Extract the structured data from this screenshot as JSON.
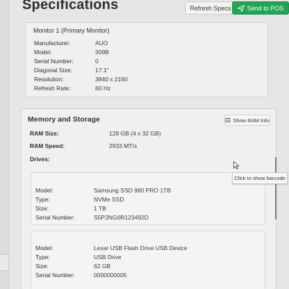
{
  "header": {
    "title": "Specifications",
    "refresh_label": "Refresh Specs",
    "send_label": "Send to POS"
  },
  "monitor": {
    "title": "Monitor 1 (Primary Monitor)",
    "rows": [
      {
        "label": "Manufacturer:",
        "value": "AUO"
      },
      {
        "label": "Model:",
        "value": "309B"
      },
      {
        "label": "Serial Number:",
        "value": "0"
      },
      {
        "label": "Diagonal Size:",
        "value": "17.1\""
      },
      {
        "label": "Resolution:",
        "value": "3840 x 2160"
      },
      {
        "label": "Refresh Rate:",
        "value": "60 Hz"
      }
    ]
  },
  "memory": {
    "title": "Memory and Storage",
    "show_ram_label": "Show RAM Info",
    "ram_size_label": "RAM Size:",
    "ram_size_value": "128 GB (4 x 32 GB)",
    "ram_speed_label": "RAM Speed:",
    "ram_speed_value": "2933 MT/s",
    "drives_label": "Drives:",
    "tooltip": "Click to show barcode",
    "drives": [
      {
        "rows": [
          {
            "label": "Model:",
            "value": "Samsung SSD 980 PRO 1TB"
          },
          {
            "label": "Type:",
            "value": "NVMe SSD"
          },
          {
            "label": "Size:",
            "value": "1 TB"
          },
          {
            "label": "Serial Number:",
            "value": "S5P2NG0R123492D"
          }
        ]
      },
      {
        "rows": [
          {
            "label": "Model:",
            "value": "Lexar USB Flash Drive USB Device"
          },
          {
            "label": "Type:",
            "value": "USB Drive"
          },
          {
            "label": "Size:",
            "value": "62 GB"
          },
          {
            "label": "Serial Number:",
            "value": "0000000005"
          }
        ]
      }
    ]
  },
  "colors": {
    "accent_green": "#23a455",
    "background": "#e6e6e4",
    "card": "#f0f0ee"
  },
  "icons": [
    "send-icon",
    "list-icon",
    "mouse-cursor-icon"
  ]
}
